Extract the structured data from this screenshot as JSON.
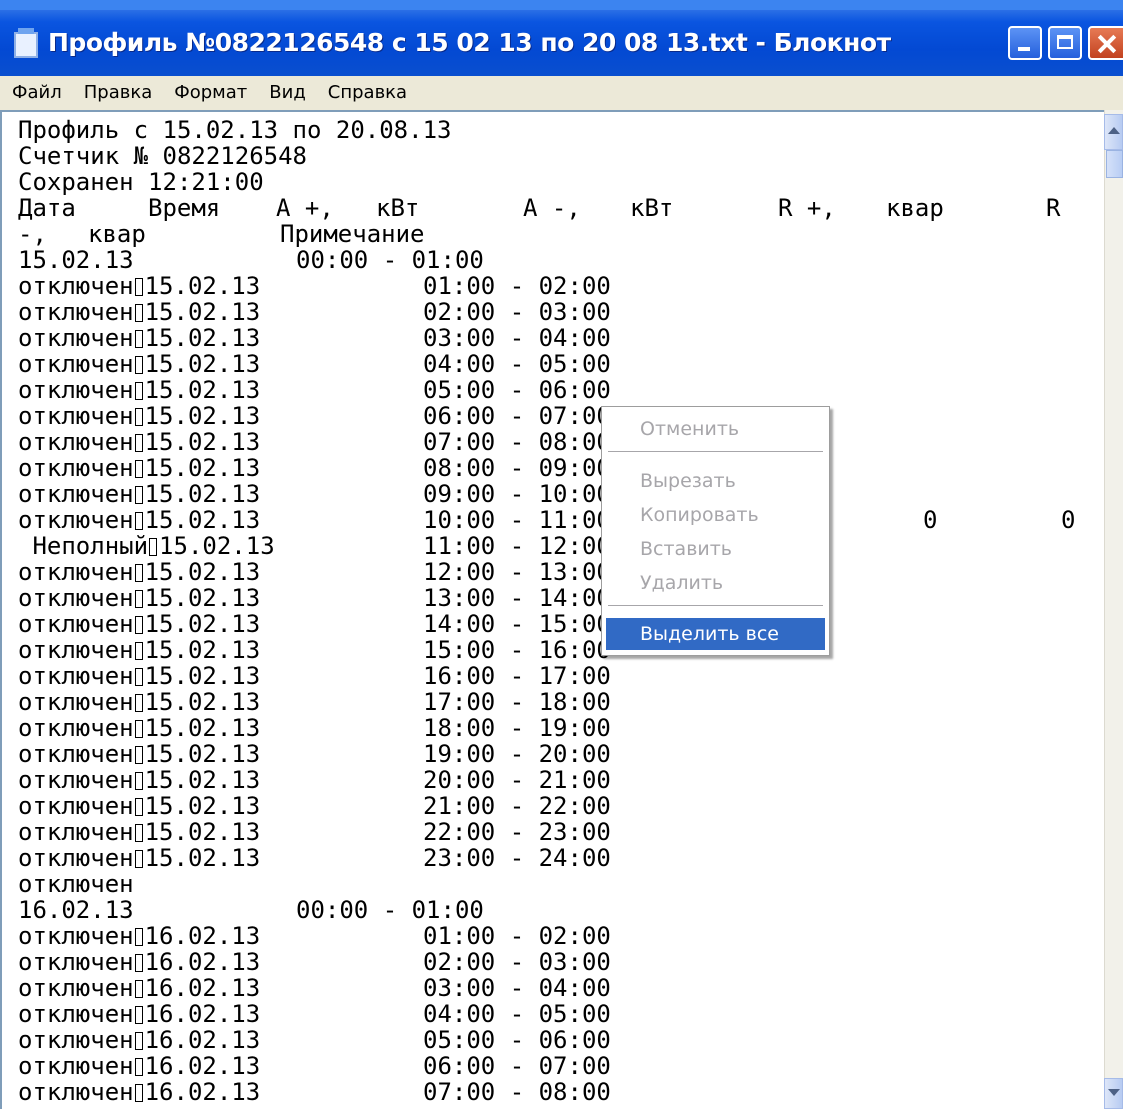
{
  "window": {
    "title": "Профиль №0822126548 с 15 02 13 по 20 08 13.txt - Блокнот"
  },
  "menu": [
    "Файл",
    "Правка",
    "Формат",
    "Вид",
    "Справка"
  ],
  "document": {
    "header": [
      "Профиль с 15.02.13 по 20.08.13",
      "Счетчик № 0822126548",
      "Сохранен 12:21:00"
    ],
    "columns_line_1": [
      "Дата",
      "Время",
      "А +,",
      "кВт",
      "А -,",
      "кВт",
      "R +,",
      "квар",
      "R"
    ],
    "columns_line_2": [
      "-,",
      "квар",
      "Примечание"
    ],
    "day1": {
      "date": "15.02.13",
      "first_interval": "00:00 - 01:00",
      "rows": [
        {
          "note": "отключен",
          "date": "15.02.13",
          "interval": "01:00 - 02:00"
        },
        {
          "note": "отключен",
          "date": "15.02.13",
          "interval": "02:00 - 03:00"
        },
        {
          "note": "отключен",
          "date": "15.02.13",
          "interval": "03:00 - 04:00"
        },
        {
          "note": "отключен",
          "date": "15.02.13",
          "interval": "04:00 - 05:00"
        },
        {
          "note": "отключен",
          "date": "15.02.13",
          "interval": "05:00 - 06:00"
        },
        {
          "note": "отключен",
          "date": "15.02.13",
          "interval": "06:00 - 07:00"
        },
        {
          "note": "отключен",
          "date": "15.02.13",
          "interval": "07:00 - 08:00"
        },
        {
          "note": "отключен",
          "date": "15.02.13",
          "interval": "08:00 - 09:00"
        },
        {
          "note": "отключен",
          "date": "15.02.13",
          "interval": "09:00 - 10:00"
        },
        {
          "note": "отключен",
          "date": "15.02.13",
          "interval": "10:00 - 11:00",
          "r_plus": "0",
          "r_minus": "0"
        },
        {
          "note": " Неполный",
          "date": "15.02.13",
          "interval": "11:00 - 12:00"
        },
        {
          "note": "отключен",
          "date": "15.02.13",
          "interval": "12:00 - 13:00"
        },
        {
          "note": "отключен",
          "date": "15.02.13",
          "interval": "13:00 - 14:00"
        },
        {
          "note": "отключен",
          "date": "15.02.13",
          "interval": "14:00 - 15:00"
        },
        {
          "note": "отключен",
          "date": "15.02.13",
          "interval": "15:00 - 16:00"
        },
        {
          "note": "отключен",
          "date": "15.02.13",
          "interval": "16:00 - 17:00"
        },
        {
          "note": "отключен",
          "date": "15.02.13",
          "interval": "17:00 - 18:00"
        },
        {
          "note": "отключен",
          "date": "15.02.13",
          "interval": "18:00 - 19:00"
        },
        {
          "note": "отключен",
          "date": "15.02.13",
          "interval": "19:00 - 20:00"
        },
        {
          "note": "отключен",
          "date": "15.02.13",
          "interval": "20:00 - 21:00"
        },
        {
          "note": "отключен",
          "date": "15.02.13",
          "interval": "21:00 - 22:00"
        },
        {
          "note": "отключен",
          "date": "15.02.13",
          "interval": "22:00 - 23:00"
        },
        {
          "note": "отключен",
          "date": "15.02.13",
          "interval": "23:00 - 24:00"
        }
      ],
      "last_note": "отключен"
    },
    "day2": {
      "date": "16.02.13",
      "first_interval": "00:00 - 01:00",
      "rows": [
        {
          "note": "отключен",
          "date": "16.02.13",
          "interval": "01:00 - 02:00"
        },
        {
          "note": "отключен",
          "date": "16.02.13",
          "interval": "02:00 - 03:00"
        },
        {
          "note": "отключен",
          "date": "16.02.13",
          "interval": "03:00 - 04:00"
        },
        {
          "note": "отключен",
          "date": "16.02.13",
          "interval": "04:00 - 05:00"
        },
        {
          "note": "отключен",
          "date": "16.02.13",
          "interval": "05:00 - 06:00"
        },
        {
          "note": "отключен",
          "date": "16.02.13",
          "interval": "06:00 - 07:00"
        },
        {
          "note": "отключен",
          "date": "16.02.13",
          "interval": "07:00 - 08:00"
        }
      ]
    }
  },
  "context_menu": {
    "items": [
      {
        "label": "Отменить",
        "enabled": false
      },
      {
        "label": "Вырезать",
        "enabled": false
      },
      {
        "label": "Копировать",
        "enabled": false
      },
      {
        "label": "Вставить",
        "enabled": false
      },
      {
        "label": "Удалить",
        "enabled": false
      },
      {
        "label": "Выделить все",
        "enabled": true,
        "highlighted": true
      }
    ]
  },
  "colors": {
    "titlebar": "#0349d3",
    "menubar": "#ece9d8",
    "selection": "#316ac5",
    "disabled_text": "#a7a6aa"
  }
}
